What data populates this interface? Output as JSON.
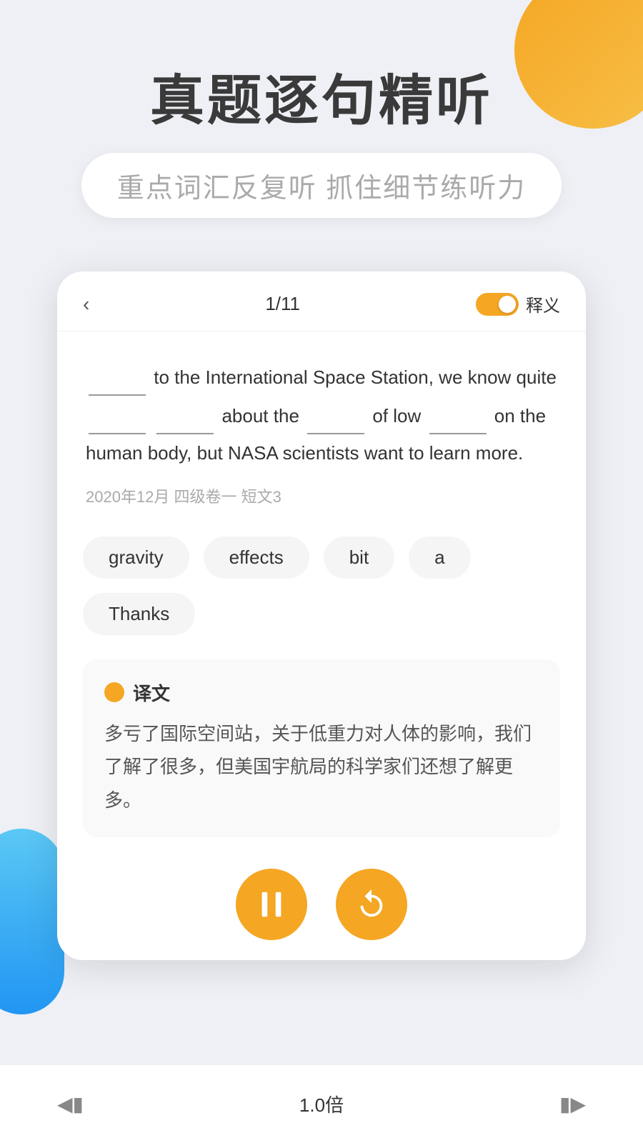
{
  "hero": {
    "title": "真题逐句精听",
    "subtitle": "重点词汇反复听  抓住细节练听力"
  },
  "card": {
    "back_label": "‹",
    "progress": "1/11",
    "toggle_label": "释义",
    "sentence": "________ to the International Space Station, we know quite ________ ________ about the ________ of low ________ on the human body, but NASA scientists want to learn more.",
    "date_label": "2020年12月 四级卷一 短文3",
    "chips": [
      "gravity",
      "effects",
      "bit",
      "a",
      "Thanks"
    ],
    "translation_title": "译文",
    "translation_body": "多亏了国际空间站，关于低重力对人体的影响，我们了解了很多，但美国宇航局的科学家们还想了解更多。"
  },
  "bottom_bar": {
    "speed_label": "1.0倍"
  },
  "colors": {
    "orange": "#f5a623",
    "blue": "#2196f3"
  }
}
